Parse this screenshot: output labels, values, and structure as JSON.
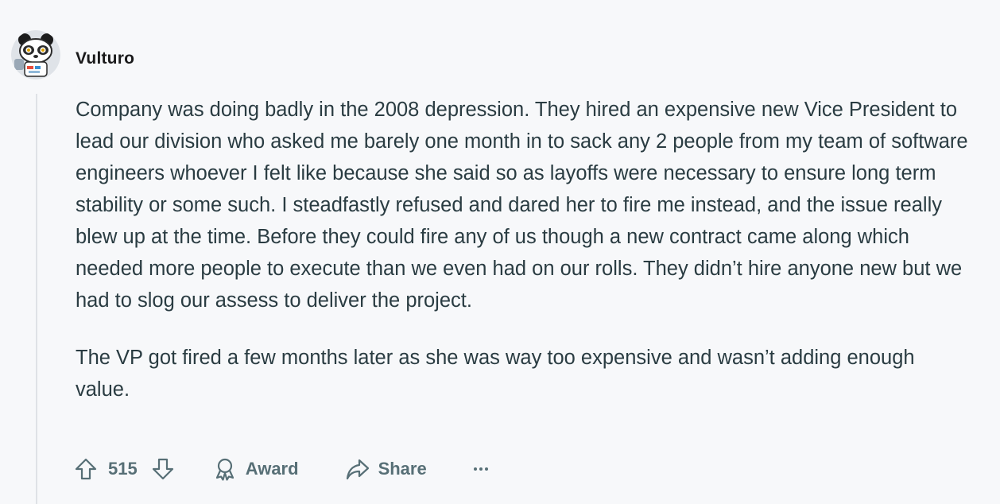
{
  "comment": {
    "author": "Vulturo",
    "paragraphs": [
      "Company was doing badly in the 2008 depression. They hired an expensive new Vice President to lead our division who asked me barely one month in to sack any 2 people from my team of software engineers whoever I felt like because she said so as layoffs were necessary to ensure long term stability or some such. I steadfastly refused and dared her to fire me instead, and the issue really blew up at the time. Before they could fire any of us though a new contract came along which needed more people to execute than we even had on our rolls. They didn’t hire anyone new but we had to slog our assess to deliver the project.",
      "The VP got fired a few months later as she was way too expensive and wasn’t adding enough value."
    ]
  },
  "actions": {
    "upvote_icon": "upvote-arrow-icon",
    "vote_count": "515",
    "downvote_icon": "downvote-arrow-icon",
    "award_icon": "award-ribbon-icon",
    "award_label": "Award",
    "share_icon": "share-arrow-icon",
    "share_label": "Share",
    "more_icon": "ellipsis-icon"
  },
  "colors": {
    "background": "#f7f8fa",
    "text": "#2a3c42",
    "action_text": "#576f76",
    "thread_line": "#dfe2e6"
  }
}
